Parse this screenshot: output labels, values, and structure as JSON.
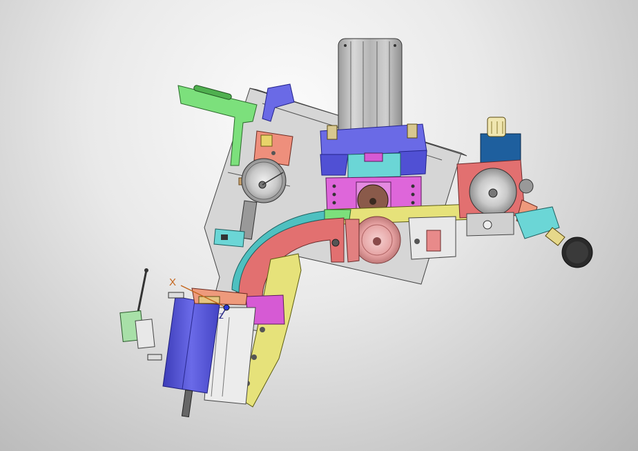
{
  "view": {
    "axis_labels": {
      "x": "X",
      "z": "Z"
    }
  },
  "colors": {
    "background_light": "#fbfbfb",
    "background_dark": "#b4b4b4",
    "blue_part": "#6666e0",
    "magenta_part": "#dc5ed8",
    "cyan_part": "#5ecece",
    "green_part": "#66dd66",
    "salmon_part": "#e07068",
    "yellow_part": "#e0e070",
    "gray_part": "#c8c8c8",
    "pink_part": "#e8a4a4",
    "axis_x": "#c4651c"
  }
}
